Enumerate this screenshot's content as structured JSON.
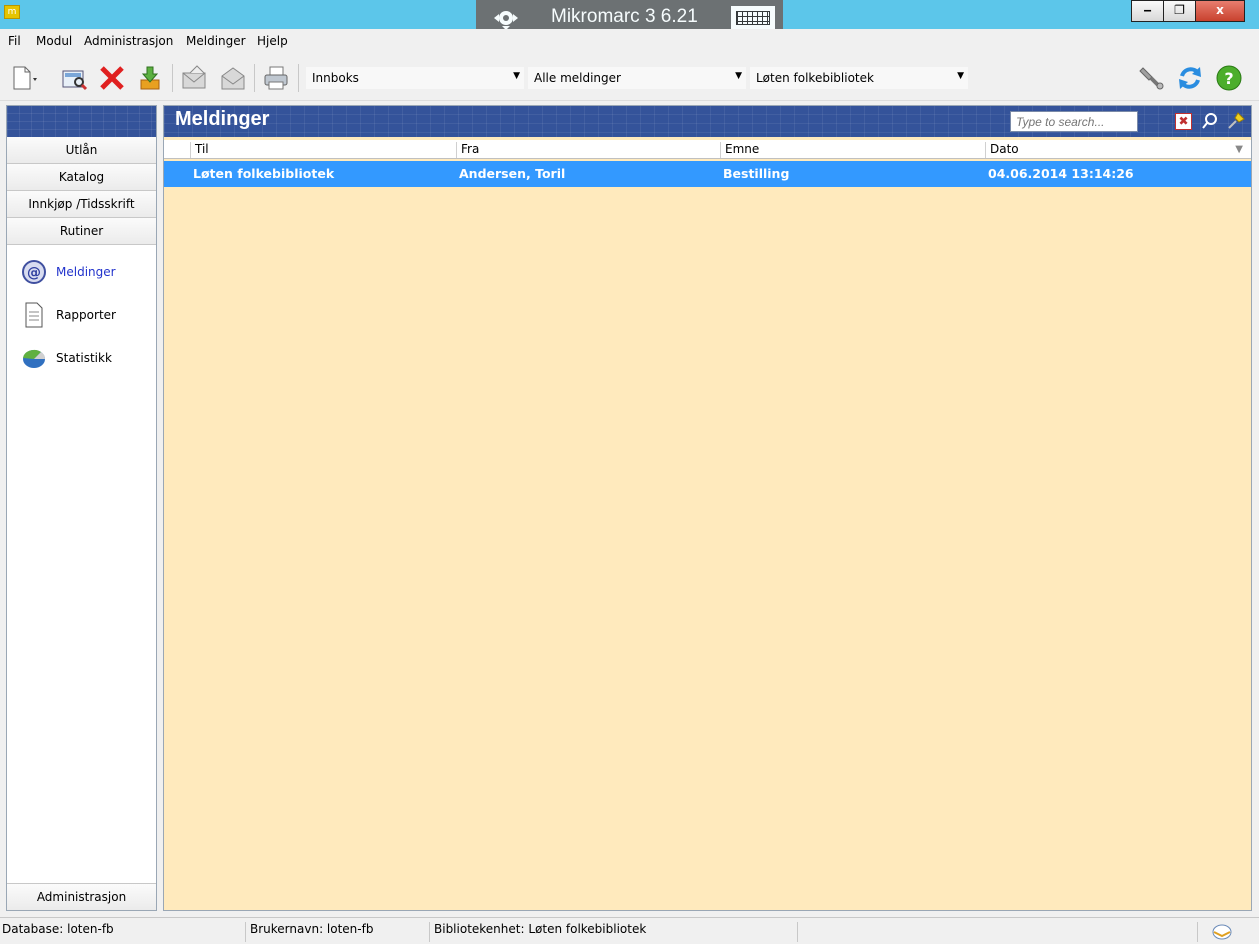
{
  "window": {
    "app_icon": "app-icon",
    "title": "Mikromarc 3 6.21",
    "buttons": {
      "minimize": "minimize-icon",
      "maximize": "restore-icon",
      "close": "close-icon"
    },
    "minimize_glyph": "‒",
    "restore_glyph": "❐",
    "close_glyph": "x"
  },
  "menu": {
    "items": [
      "Fil",
      "Modul",
      "Administrasjon",
      "Meldinger",
      "Hjelp"
    ]
  },
  "toolbar": {
    "folder_value": "Innboks",
    "filter_value": "Alle meldinger",
    "library_value": "Løten folkebibliotek",
    "icons": [
      "new-document-icon",
      "preview-icon",
      "delete-icon",
      "download-icon",
      "send-mail-icon",
      "open-mail-icon",
      "print-icon",
      "tools-icon",
      "refresh-icon",
      "help-icon"
    ]
  },
  "sidebar": {
    "buttons": [
      "Utlån",
      "Katalog",
      "Innkjøp /Tidsskrift",
      "Rutiner"
    ],
    "links": [
      {
        "label": "Meldinger",
        "icon": "at-sign-icon",
        "active": true
      },
      {
        "label": "Rapporter",
        "icon": "report-icon",
        "active": false
      },
      {
        "label": "Statistikk",
        "icon": "statistics-icon",
        "active": false
      }
    ],
    "bottom_button": "Administrasjon"
  },
  "main": {
    "title": "Meldinger",
    "search_placeholder": "Type to search...",
    "columns": [
      "Til",
      "Fra",
      "Emne",
      "Dato"
    ],
    "rows": [
      {
        "til": "Løten folkebibliotek",
        "fra": "Andersen, Toril",
        "emne": "Bestilling",
        "dato": "04.06.2014 13:14:26",
        "selected": true
      }
    ]
  },
  "status": {
    "database": "Database: loten-fb",
    "user": "Brukernavn: loten-fb",
    "unit": "Bibliotekenhet: Løten folkebibliotek"
  },
  "colors": {
    "titlebar": "#5cc6ea",
    "header_blue": "#34539a",
    "content_bg": "#ffeabd",
    "selection": "#3399ff"
  }
}
